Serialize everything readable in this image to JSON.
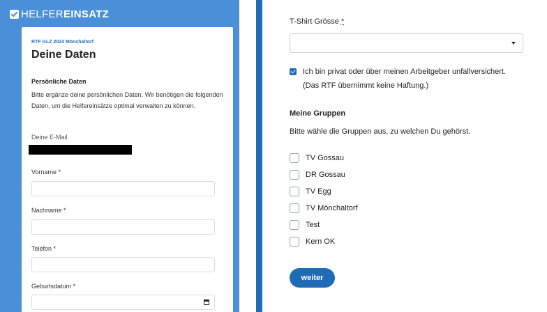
{
  "brand": {
    "light": "HELFER",
    "bold": "EINSATZ"
  },
  "left": {
    "event": "RTF GLZ 2024 Mönchaltorf",
    "title": "Deine Daten",
    "section_title": "Persönliche Daten",
    "section_text": "Bitte ergänze deine persönlichen Daten. Wir benötigen die folgenden Daten, um die Helfereinsätze optimal verwalten zu können.",
    "email_label": "Deine E-Mail",
    "fields": {
      "vorname": "Vorname",
      "nachname": "Nachname",
      "telefon": "Telefon",
      "geburtsdatum": "Geburtsdatum"
    },
    "required_mark": "*"
  },
  "right": {
    "tshirt_label": "T-Shirt Grösse",
    "tshirt_value": "",
    "required_mark": "*",
    "consent_line1": "Ich bin privat oder über meinen Arbeitgeber unfallversichert.",
    "consent_line2": "(Das RTF übernimmt keine Haftung.)",
    "consent_checked": true,
    "groups_title": "Meine Gruppen",
    "groups_text": "Bitte wähle die Gruppen aus, zu welchen Du gehörst.",
    "groups": [
      {
        "label": "TV Gossau",
        "checked": false
      },
      {
        "label": "DR Gossau",
        "checked": false
      },
      {
        "label": "TV Egg",
        "checked": false
      },
      {
        "label": "TV Mönchaltorf",
        "checked": false
      },
      {
        "label": "Test",
        "checked": false
      },
      {
        "label": "Kern OK",
        "checked": false
      }
    ],
    "submit_label": "weiter"
  },
  "colors": {
    "left_bg": "#4a8fd8",
    "accent": "#1f6bb5",
    "event_text": "#2a6fc0"
  },
  "icons": {
    "brand": "check-square-icon",
    "select": "chevron-down-icon",
    "date": "calendar-icon"
  }
}
